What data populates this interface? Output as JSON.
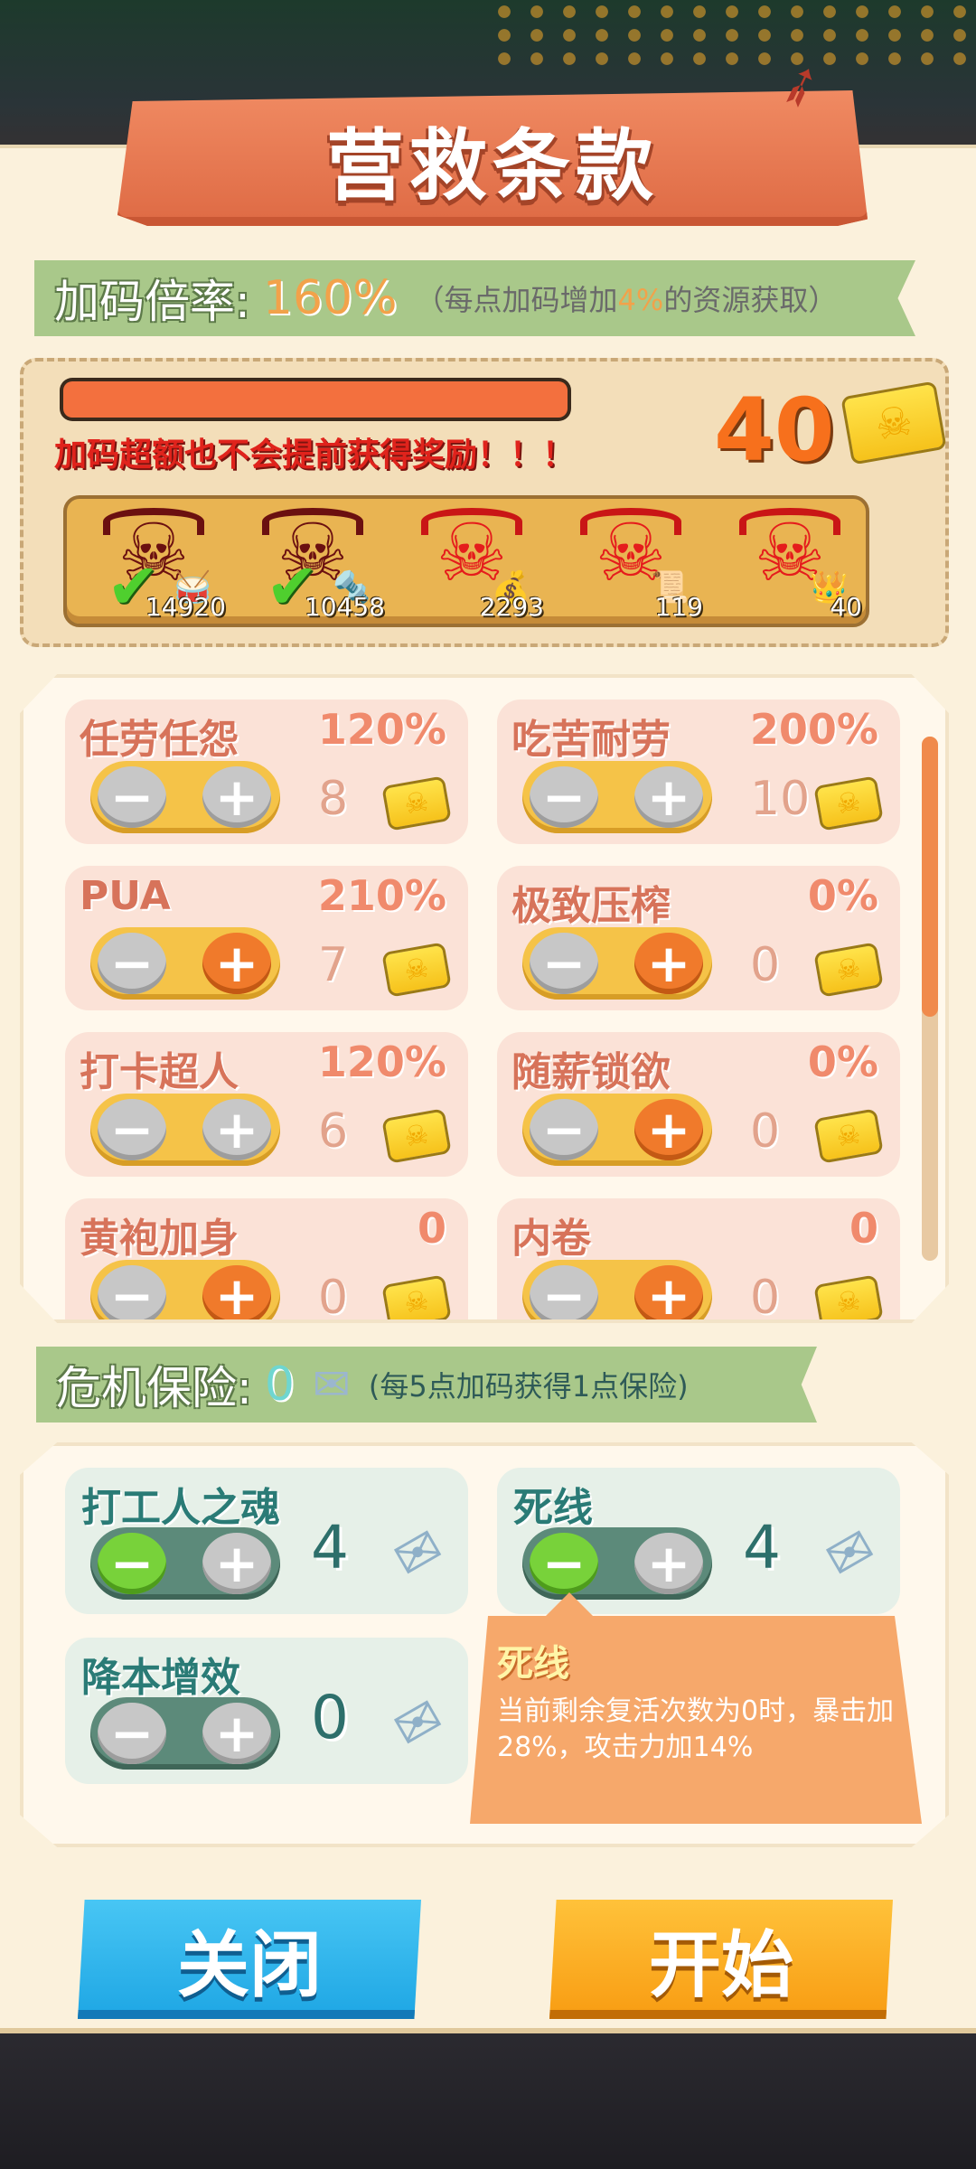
{
  "title": "营救条款",
  "multiplier": {
    "label": "加码倍率:",
    "value": "160%",
    "note_prefix": "（每点加码增加",
    "note_highlight": "4%",
    "note_suffix": "的资源获取）"
  },
  "progress": {
    "fill_fraction": 1.0,
    "color": "#f3703e"
  },
  "warning": "加码超额也不会提前获得奖励！！！",
  "ticket_total": "40",
  "rewards": [
    {
      "count": "14920",
      "completed": true,
      "icon": "drum-icon"
    },
    {
      "count": "10458",
      "completed": true,
      "icon": "screw-icon"
    },
    {
      "count": "2293",
      "completed": false,
      "icon": "bag-icon"
    },
    {
      "count": "119",
      "completed": false,
      "icon": "scroll-icon"
    },
    {
      "count": "40",
      "completed": false,
      "icon": "crown-icon"
    }
  ],
  "options": [
    {
      "name": "任劳任怨",
      "pct": "120%",
      "count": "8",
      "plus_active": false
    },
    {
      "name": "吃苦耐劳",
      "pct": "200%",
      "count": "10",
      "plus_active": false
    },
    {
      "name": "PUA",
      "pct": "210%",
      "count": "7",
      "plus_active": true
    },
    {
      "name": "极致压榨",
      "pct": "0%",
      "count": "0",
      "plus_active": true
    },
    {
      "name": "打卡超人",
      "pct": "120%",
      "count": "6",
      "plus_active": false
    },
    {
      "name": "随薪锁欲",
      "pct": "0%",
      "count": "0",
      "plus_active": true
    },
    {
      "name": "黄袍加身",
      "pct": "0",
      "count": "0",
      "plus_active": true
    },
    {
      "name": "内卷",
      "pct": "0",
      "count": "0",
      "plus_active": true
    }
  ],
  "insurance": {
    "label": "危机保险:",
    "value": "0",
    "note": "(每5点加码获得1点保险)"
  },
  "insurance_options": [
    {
      "name": "打工人之魂",
      "count": "4",
      "minus_active": true
    },
    {
      "name": "死线",
      "count": "4",
      "minus_active": true
    },
    {
      "name": "降本增效",
      "count": "0",
      "minus_active": false
    }
  ],
  "tooltip": {
    "title": "死线",
    "body": "当前剩余复活次数为0时，暴击加28%，攻击力加14%"
  },
  "buttons": {
    "close": "关闭",
    "start": "开始"
  },
  "colors": {
    "accent_orange": "#f2a24a",
    "header_green": "#a9c88a",
    "close_blue": "#1ea6e4",
    "start_orange": "#f89c12"
  }
}
